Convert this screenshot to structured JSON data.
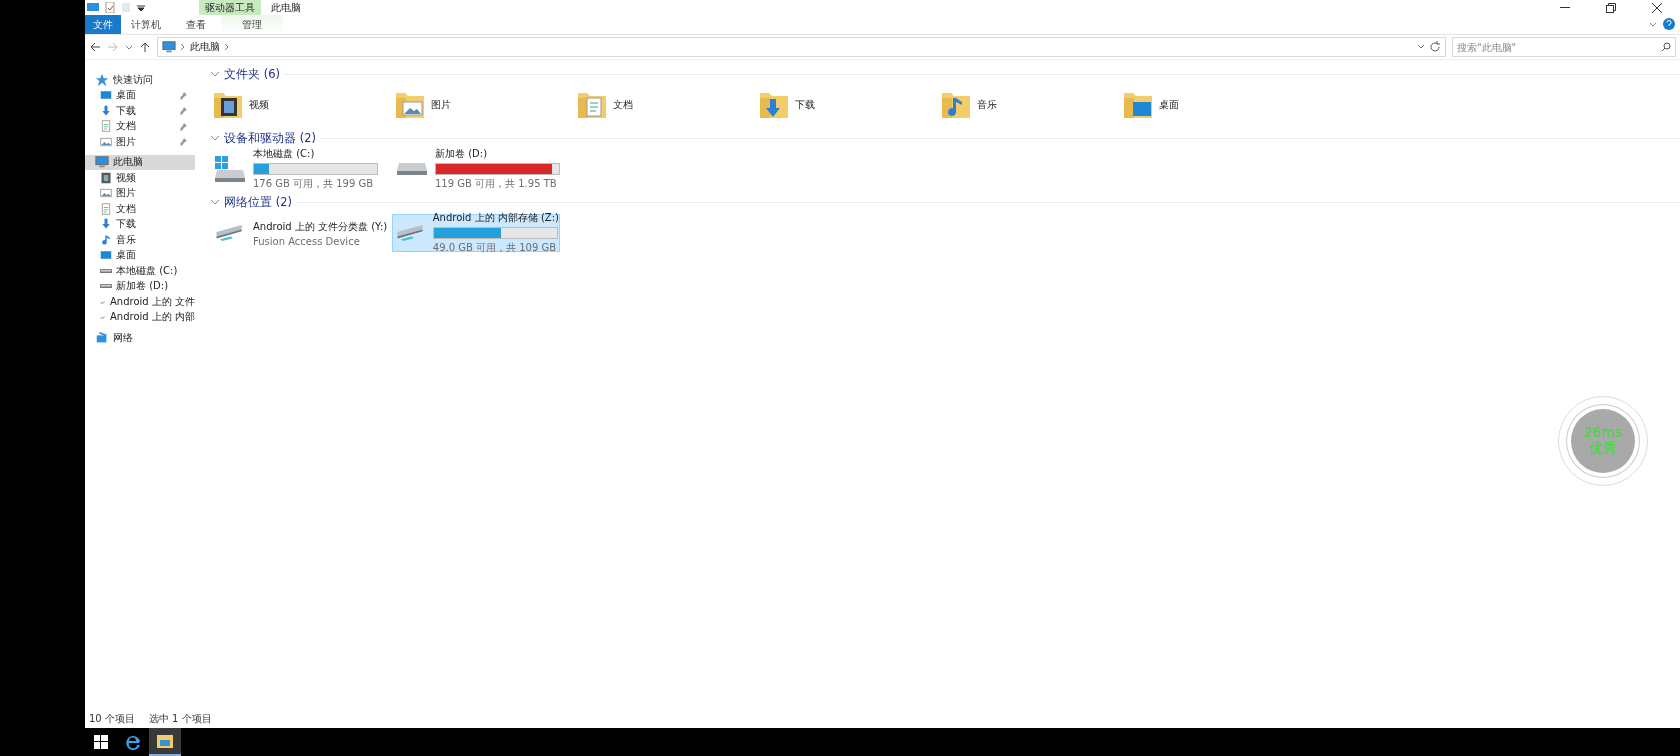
{
  "title_bar": {
    "context_group": "驱动器工具",
    "title": "此电脑"
  },
  "ribbon": {
    "file_button": "文件",
    "tabs": [
      {
        "label": "计算机",
        "selected": false,
        "kind": "tab"
      },
      {
        "label": "查看",
        "selected": false,
        "kind": "tab"
      },
      {
        "label": "管理",
        "selected": false,
        "kind": "context"
      }
    ]
  },
  "address_bar": {
    "path": [
      "此电脑"
    ],
    "search_placeholder": "搜索\"此电脑\""
  },
  "sidebar": {
    "items": [
      {
        "label": "快速访问",
        "kind": "star",
        "selected": false,
        "children": [
          {
            "label": "桌面",
            "kind": "desktop",
            "pinned": true,
            "selected": false
          },
          {
            "label": "下载",
            "kind": "download",
            "pinned": true,
            "selected": false
          },
          {
            "label": "文档",
            "kind": "document",
            "pinned": true,
            "selected": false
          },
          {
            "label": "图片",
            "kind": "picture",
            "pinned": true,
            "selected": false
          }
        ]
      },
      {
        "label": "此电脑",
        "kind": "pc",
        "selected": true,
        "children": [
          {
            "label": "视频",
            "kind": "video",
            "pinned": false,
            "selected": false
          },
          {
            "label": "图片",
            "kind": "picture",
            "pinned": false,
            "selected": false
          },
          {
            "label": "文档",
            "kind": "document",
            "pinned": false,
            "selected": false
          },
          {
            "label": "下载",
            "kind": "download",
            "pinned": false,
            "selected": false
          },
          {
            "label": "音乐",
            "kind": "music",
            "pinned": false,
            "selected": false
          },
          {
            "label": "桌面",
            "kind": "desktop",
            "pinned": false,
            "selected": false
          },
          {
            "label": "本地磁盘 (C:)",
            "kind": "drive",
            "pinned": false,
            "selected": false
          },
          {
            "label": "新加卷 (D:)",
            "kind": "drive",
            "pinned": false,
            "selected": false
          },
          {
            "label": "Android 上的 文件",
            "kind": "phone",
            "pinned": false,
            "selected": false
          },
          {
            "label": "Android 上的 内部",
            "kind": "phone",
            "pinned": false,
            "selected": false
          }
        ]
      },
      {
        "label": "网络",
        "kind": "network",
        "selected": false
      }
    ]
  },
  "sections": [
    {
      "title": "文件夹 (6)",
      "expanded": true,
      "items": [
        {
          "kind": "video",
          "label": "视频"
        },
        {
          "kind": "picture",
          "label": "图片"
        },
        {
          "kind": "document",
          "label": "文档"
        },
        {
          "kind": "download",
          "label": "下载"
        },
        {
          "kind": "music",
          "label": "音乐"
        },
        {
          "kind": "desktop",
          "label": "桌面"
        }
      ]
    },
    {
      "title": "设备和驱动器 (2)",
      "expanded": true,
      "items": [
        {
          "kind": "system_drive",
          "label": "本地磁盘 (C:)",
          "level": 0.12,
          "detail": "176 GB 可用，共 199 GB",
          "selected": false,
          "color": "#26a0da"
        },
        {
          "kind": "drive",
          "label": "新加卷 (D:)",
          "level": 0.94,
          "detail": "119 GB 可用，共 1.95 TB",
          "selected": false,
          "color": "#da2626"
        }
      ]
    },
    {
      "title": "网络位置 (2)",
      "expanded": true,
      "items": [
        {
          "kind": "network_drive",
          "label": "Android 上的 文件分类盘 (Y:)",
          "detail": "Fusion Access Device",
          "selected": false
        },
        {
          "kind": "network_drive",
          "label": "Android 上的 内部存储 (Z:)",
          "level": 0.55,
          "detail": "49.0 GB 可用，共 109 GB",
          "selected": true,
          "color": "#26a0da"
        }
      ]
    }
  ],
  "status_bar": [
    "10 个项目",
    "选中 1 个项目"
  ],
  "taskbar": [
    {
      "kind": "start",
      "selected": false
    },
    {
      "kind": "browser",
      "selected": false
    },
    {
      "kind": "explorer",
      "selected": true
    }
  ],
  "latency_badge": {
    "value": "26ms",
    "rating": "优秀"
  }
}
